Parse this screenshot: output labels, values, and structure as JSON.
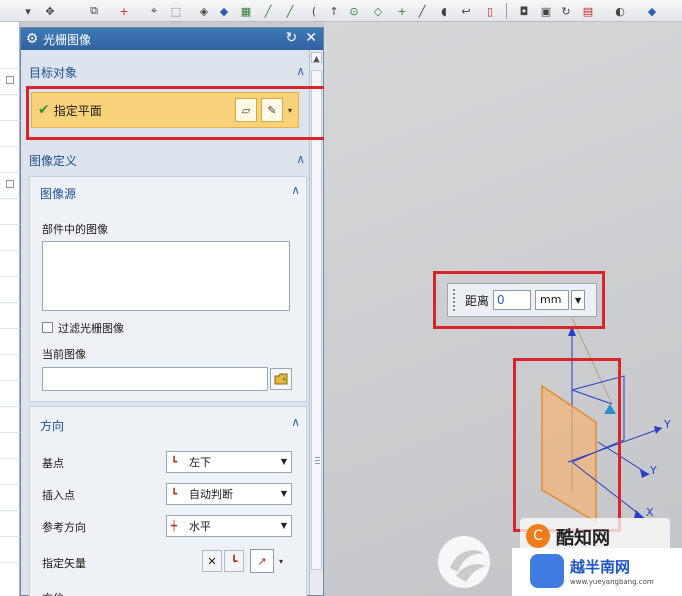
{
  "dialog": {
    "title": "光栅图像",
    "target_section": {
      "heading": "目标对象",
      "select_label": "指定平面"
    },
    "image_definition": {
      "heading": "图像定义",
      "source_heading": "图像源",
      "images_in_part_label": "部件中的图像",
      "filter_label": "过滤光栅图像",
      "current_image_label": "当前图像",
      "current_image_value": ""
    },
    "orientation": {
      "heading": "方向",
      "base_point_label": "基点",
      "base_point_value": "左下",
      "insert_point_label": "插入点",
      "insert_point_value": "自动判断",
      "ref_direction_label": "参考方向",
      "ref_direction_value": "水平",
      "vector_label": "指定矢量",
      "next_label": "方位"
    }
  },
  "distance_input": {
    "label": "距离",
    "value": "0",
    "unit": "mm"
  },
  "axis_labels": {
    "y1": "Y",
    "y2": "Y",
    "x": "X"
  },
  "watermark": {
    "brand": "酷知网",
    "site_cn": "越半南网",
    "site_url": "www.yueyangbang.com"
  },
  "colors": {
    "highlight_box": "#d6262b",
    "selection_row": "#f7d27a",
    "title_bar": "#3f79b6",
    "plane_fill": "#f0b47a"
  },
  "icons": [
    "gear-icon",
    "reset-icon",
    "close-icon",
    "checkmark-icon",
    "plane-dialog-icon",
    "select-plane-icon",
    "folder-icon",
    "base-point-icon",
    "insert-point-icon",
    "ref-direction-icon",
    "vector-icon"
  ]
}
